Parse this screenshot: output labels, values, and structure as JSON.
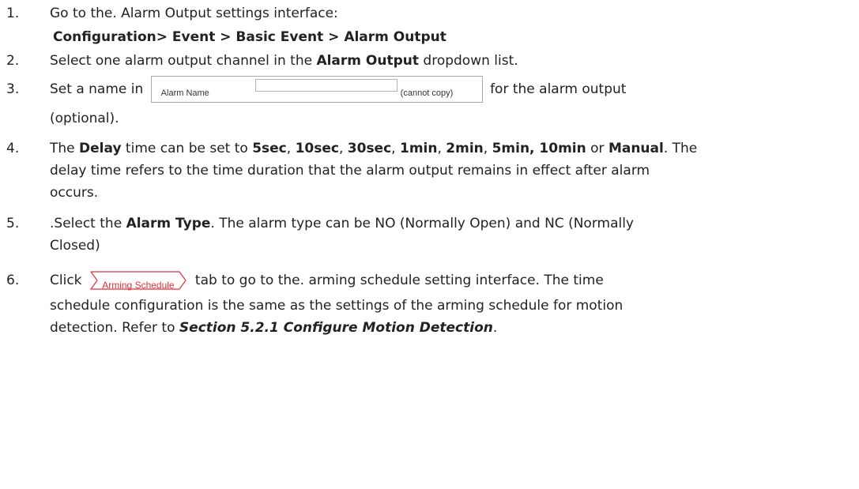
{
  "steps": [
    {
      "num": "1.",
      "text": "Go to the. Alarm Output settings interface:"
    },
    {
      "path": "Configuration> Event > Basic Event > Alarm Output"
    },
    {
      "num": "2.",
      "pre": "Select one alarm output channel in the ",
      "bold": "Alarm Output",
      "post": " dropdown list."
    },
    {
      "num": "3.",
      "pre": "Set a name in ",
      "post": " for the alarm output",
      "cont": "(optional)."
    },
    {
      "num": "4.",
      "s1": "The ",
      "b1": "Delay",
      "s2": " time can be set to ",
      "b2": "5sec",
      "c1": ", ",
      "b3": "10sec",
      "c2": ", ",
      "b4": "30sec",
      "c3": ", ",
      "b5": "1min",
      "c4": ", ",
      "b6": "2min",
      "c5": ", ",
      "b7": "5min, 10min",
      "s3": " or ",
      "b8": "Manual",
      "s4": ". The",
      "line2": "delay time refers to the time duration that the alarm output remains in effect after alarm",
      "line3": "occurs."
    },
    {
      "num": "5.",
      "pre": ".Select the ",
      "bold": "Alarm Type",
      "post": ". The alarm type can be NO (Normally Open) and NC (Normally",
      "cont": "Closed)"
    },
    {
      "num": "6.",
      "pre": "Click ",
      "post": "tab to go to the. arming schedule setting interface. The time",
      "line2": "schedule configuration is the same as the settings of the arming schedule for motion",
      "line3_pre": "detection. Refer to ",
      "line3_ref": "Section 5.2.1 Configure Motion Detection",
      "line3_post": "."
    }
  ],
  "alarm_name_widget": {
    "label": "Alarm Name",
    "hint": "(cannot copy)"
  },
  "arming_tab": {
    "label": "Arming Schedule",
    "color": "#e0303a"
  }
}
